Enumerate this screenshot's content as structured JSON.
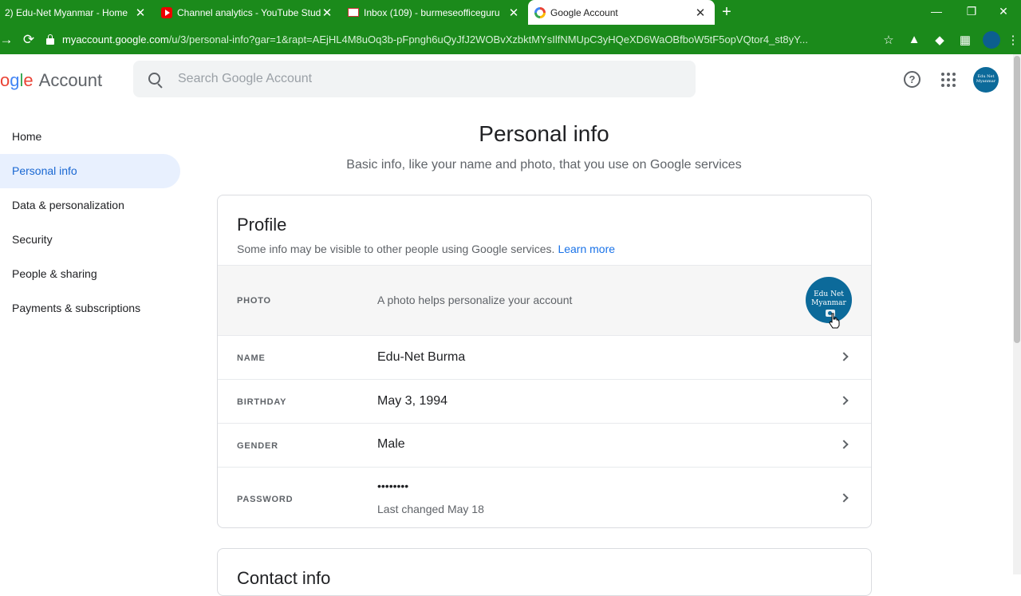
{
  "browser": {
    "tabs": [
      {
        "title": "2) Edu-Net Myanmar - Home",
        "icon": "home-tab-icon"
      },
      {
        "title": "Channel analytics - YouTube Studio",
        "icon": "youtube-icon"
      },
      {
        "title": "Inbox (109) - burmeseofficeguru",
        "icon": "gmail-icon"
      },
      {
        "title": "Google Account",
        "icon": "google-icon"
      }
    ],
    "new_tab_glyph": "+",
    "close_glyph": "✕",
    "window_controls": {
      "minimize": "—",
      "restore": "❐",
      "close": "✕"
    },
    "url_host": "myaccount.google.com",
    "url_path": "/u/3/personal-info?gar=1&rapt=AEjHL4M8uOq3b-pFpngh6uQyJfJ2WOBvXzbktMYsIlfNMUpC3yHQeXD6WaOBfboW5tF5opVQtor4_st8yY...",
    "nav": {
      "back": "→",
      "reload": "⟳"
    },
    "star_glyph": "☆"
  },
  "header": {
    "logo_parts": [
      "o",
      "g",
      "l",
      "e"
    ],
    "logo_account": "Account",
    "search_placeholder": "Search Google Account",
    "help_glyph": "?",
    "avatar_text_1": "Edu Net",
    "avatar_text_2": "Myanmar"
  },
  "sidebar": {
    "items": [
      {
        "label": "Home",
        "active": false
      },
      {
        "label": "Personal info",
        "active": true
      },
      {
        "label": "Data & personalization",
        "active": false
      },
      {
        "label": "Security",
        "active": false
      },
      {
        "label": "People & sharing",
        "active": false
      },
      {
        "label": "Payments & subscriptions",
        "active": false
      }
    ]
  },
  "main": {
    "title": "Personal info",
    "subtitle": "Basic info, like your name and photo, that you use on Google services",
    "profile": {
      "title": "Profile",
      "description": "Some info may be visible to other people using Google services.",
      "learn_more": "Learn more",
      "rows": {
        "photo": {
          "label": "PHOTO",
          "value": "A photo helps personalize your account",
          "photo_line1": "Edu Net",
          "photo_line2": "Myanmar"
        },
        "name": {
          "label": "NAME",
          "value": "Edu-Net Burma"
        },
        "birthday": {
          "label": "BIRTHDAY",
          "value": "May 3, 1994"
        },
        "gender": {
          "label": "GENDER",
          "value": "Male"
        },
        "password": {
          "label": "PASSWORD",
          "value": "••••••••",
          "sub": "Last changed May 18"
        }
      }
    },
    "next_card_title": "Contact info"
  },
  "colors": {
    "browser_frame": "#1b8a1b",
    "accent_blue": "#1a73e8",
    "active_nav_bg": "#e8f0fe",
    "active_nav_text": "#1967d2",
    "avatar_bg": "#0c6a9a"
  }
}
